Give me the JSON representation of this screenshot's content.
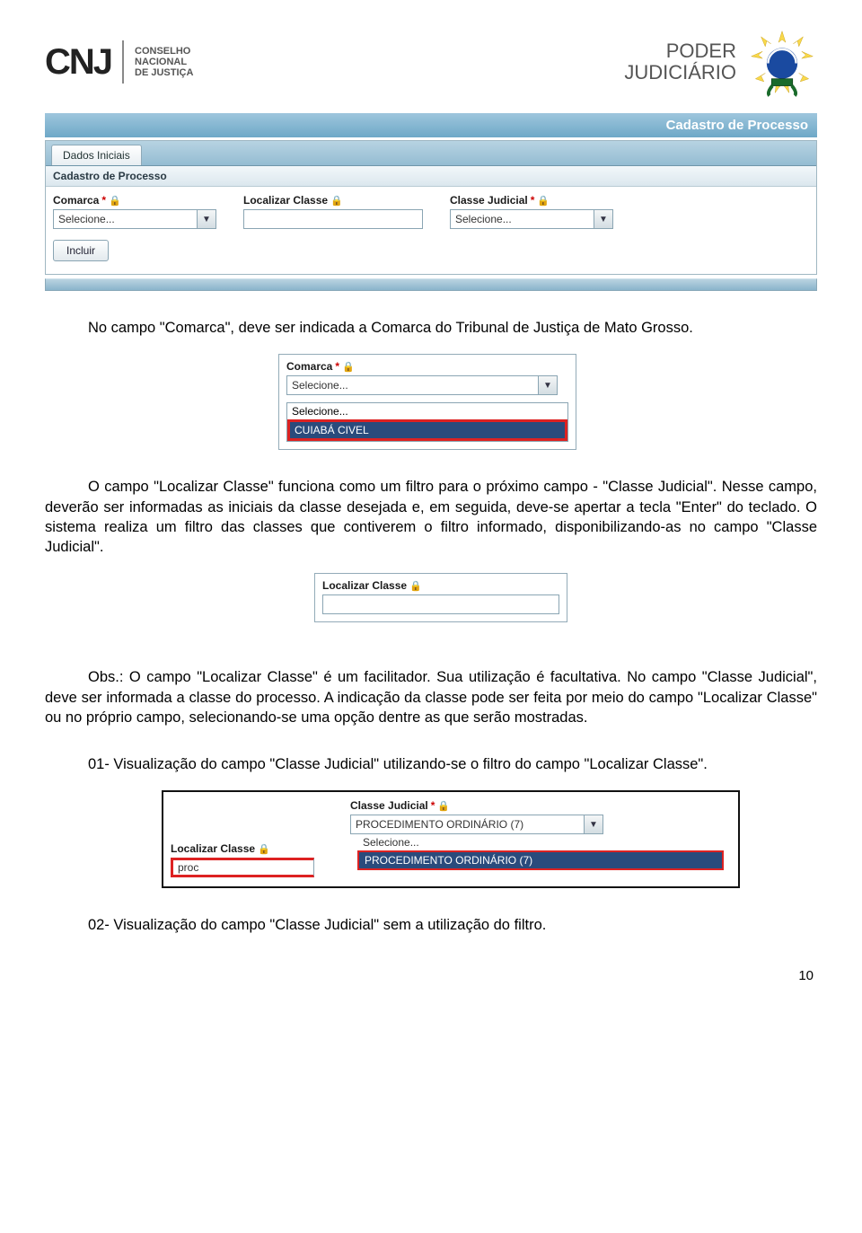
{
  "header": {
    "cnj_mark": "CNJ",
    "cnj_line1": "CONSELHO",
    "cnj_line2": "NACIONAL",
    "cnj_line3": "DE JUSTIÇA",
    "poder": "PODER",
    "judiciario": "JUDICIÁRIO",
    "doc_title": "Cadastro de Processo"
  },
  "shot1": {
    "tab": "Dados Iniciais",
    "panel_title": "Cadastro de Processo",
    "comarca_label": "Comarca",
    "comarca_value": "Selecione...",
    "loc_label": "Localizar Classe",
    "loc_value": "",
    "cj_label": "Classe Judicial",
    "cj_value": "Selecione...",
    "btn_incluir": "Incluir"
  },
  "para1": "No campo \"Comarca\", deve ser indicada a Comarca do Tribunal de Justiça de Mato Grosso.",
  "shot2": {
    "label": "Comarca",
    "value": "Selecione...",
    "opt_blank": "Selecione...",
    "opt_sel": "CUIABÁ CIVEL"
  },
  "para2": "O campo \"Localizar Classe\" funciona como um filtro para o próximo campo - \"Classe Judicial\". Nesse campo, deverão ser informadas as iniciais da classe desejada e, em seguida, deve-se apertar a tecla \"Enter\" do teclado. O sistema realiza um filtro das classes que contiverem o filtro informado, disponibilizando-as no campo \"Classe Judicial\".",
  "shot3": {
    "label": "Localizar Classe",
    "value": ""
  },
  "para3": "Obs.: O campo \"Localizar Classe\" é um facilitador. Sua utilização é facultativa. No campo \"Classe Judicial\", deve ser informada a classe do processo. A indicação da classe pode ser feita por meio do campo \"Localizar Classe\" ou no próprio campo, selecionando-se uma opção dentre as que serão mostradas.",
  "para4": "01- Visualização do campo \"Classe Judicial\" utilizando-se o filtro do campo \"Localizar Classe\".",
  "shot4": {
    "loc_label": "Localizar Classe",
    "loc_value": "proc",
    "cj_label": "Classe Judicial",
    "cj_value": "PROCEDIMENTO ORDINÁRIO (7)",
    "opt_blank": "Selecione...",
    "opt_sel": "PROCEDIMENTO ORDINÁRIO (7)"
  },
  "para5": "02- Visualização do campo \"Classe Judicial\" sem a utilização do filtro.",
  "page_number": "10",
  "glyphs": {
    "star": "*",
    "lock": "🔒",
    "chev": "▼"
  }
}
